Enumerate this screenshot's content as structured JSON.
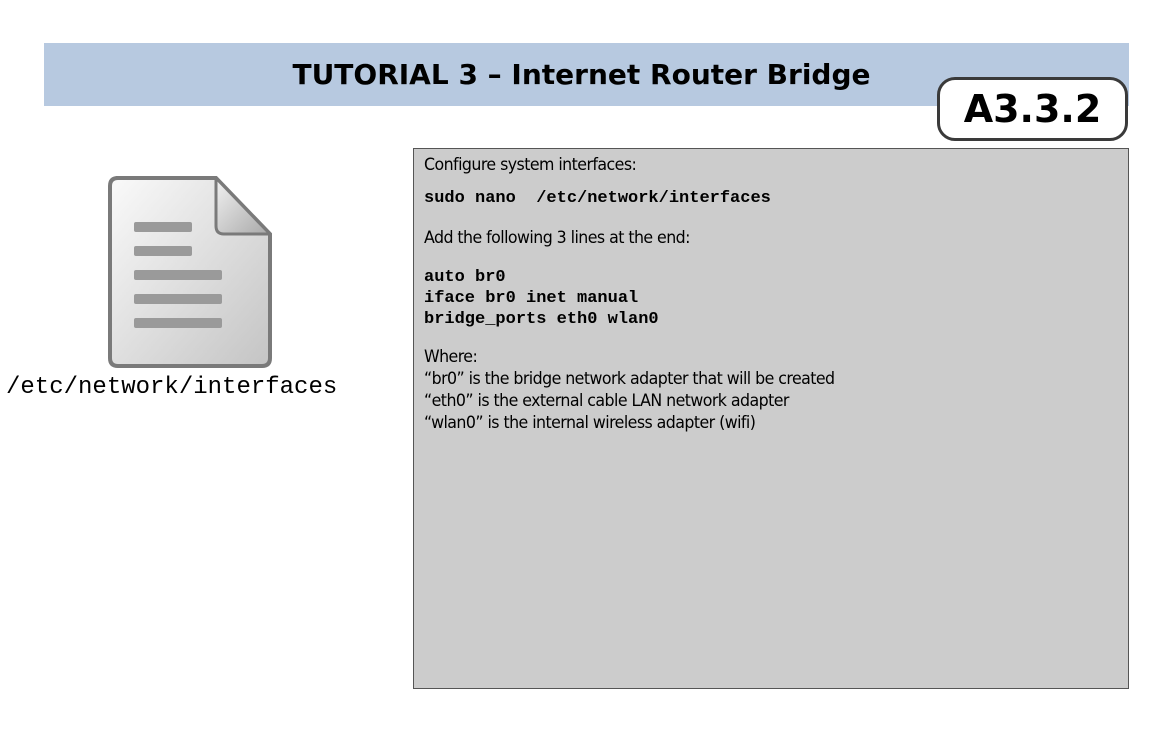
{
  "header": {
    "title": "TUTORIAL 3 – Internet Router Bridge",
    "badge": "A3.3.2",
    "band_color": "#b7c9e0"
  },
  "file_icon": {
    "icon": "document-icon",
    "caption": "/etc/network/interfaces"
  },
  "content": {
    "intro": "Configure system interfaces:",
    "command": "sudo nano  /etc/network/interfaces",
    "add_lines_text": "Add the following 3 lines at the end:",
    "config_lines": [
      "auto br0",
      "iface br0 inet manual",
      "bridge_ports eth0 wlan0"
    ],
    "where_label": "Where:",
    "explanations": [
      "“br0” is the bridge network adapter that will be created",
      "“eth0” is the external cable LAN network adapter",
      "“wlan0” is the internal wireless adapter (wifi)"
    ],
    "box_color": "#cccccc"
  }
}
